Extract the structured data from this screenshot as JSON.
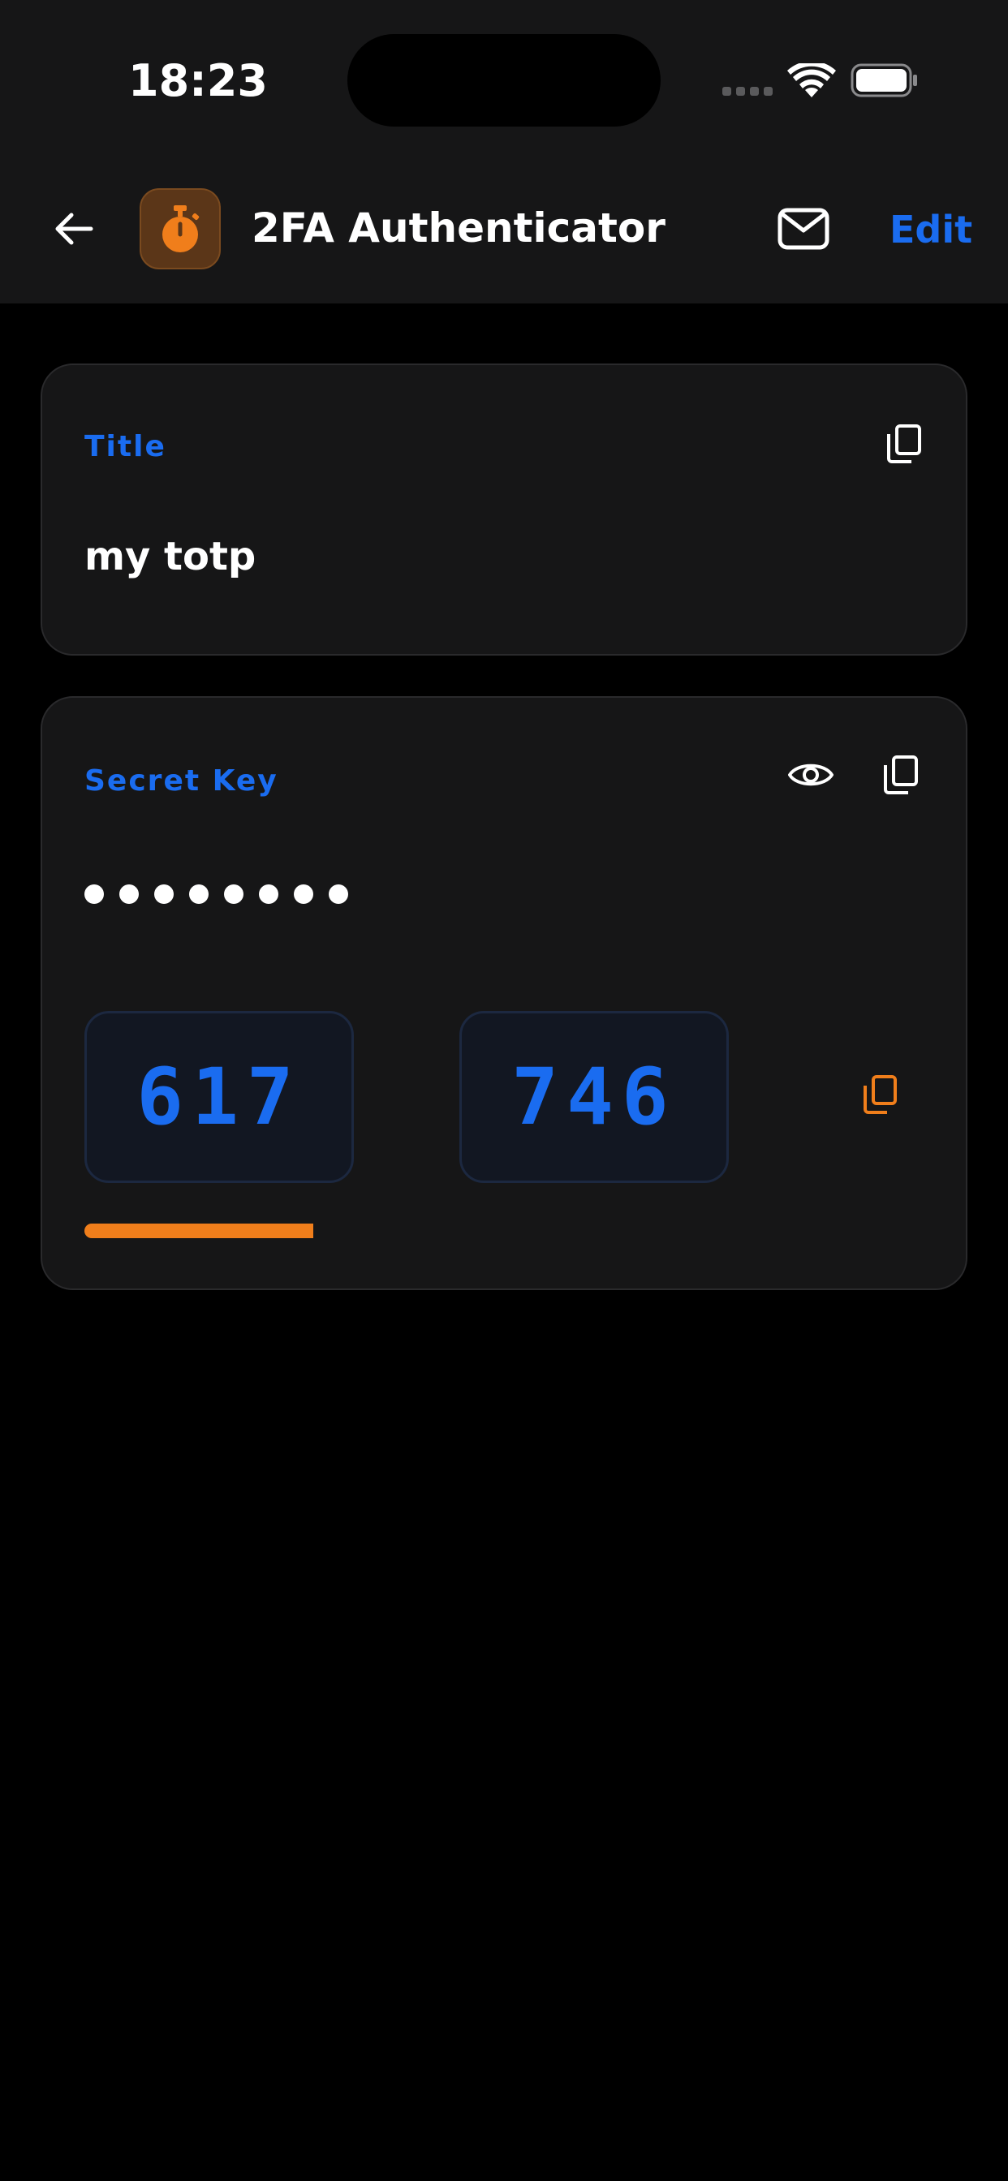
{
  "status_bar": {
    "time": "18:23"
  },
  "nav": {
    "title": "2FA Authenticator",
    "edit_label": "Edit",
    "app_icon": "stopwatch-icon"
  },
  "title_field": {
    "label": "Title",
    "value": "my totp"
  },
  "secret_field": {
    "label": "Secret Key",
    "masked_dots": 8
  },
  "totp": {
    "code_part1": "617",
    "code_part2": "746",
    "remaining_fraction": 0.272
  },
  "colors": {
    "accent": "#1a6cf0",
    "orange": "#f07e1b",
    "card_bg": "#161617",
    "background": "#000000"
  }
}
